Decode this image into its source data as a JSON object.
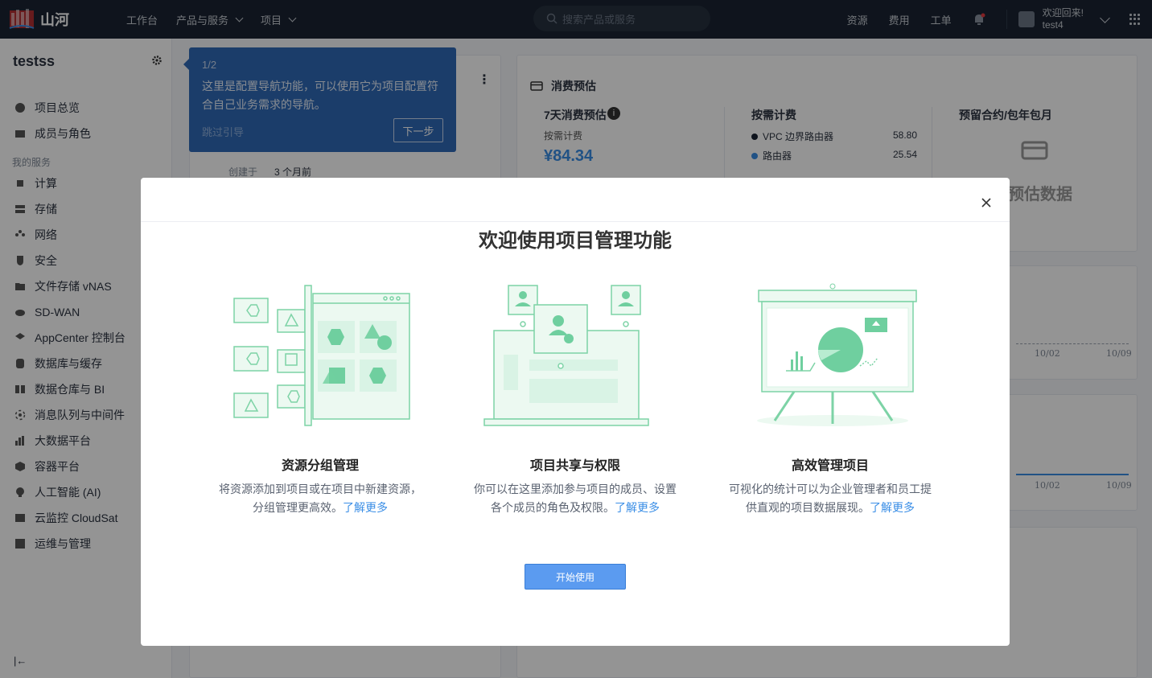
{
  "brand": {
    "name": "山河",
    "accent": "#3a8ee6"
  },
  "topbar": {
    "nav": [
      {
        "label": "工作台",
        "dropdown": false
      },
      {
        "label": "产品与服务",
        "dropdown": true
      },
      {
        "label": "项目",
        "dropdown": true
      }
    ],
    "search_placeholder": "搜索产品或服务",
    "links": [
      "资源",
      "费用",
      "工单"
    ],
    "welcome": "欢迎回来!",
    "username": "test4"
  },
  "sidebar": {
    "project_name": "testss",
    "top_items": [
      {
        "label": "项目总览",
        "icon": "overview-icon"
      },
      {
        "label": "成员与角色",
        "icon": "members-icon"
      }
    ],
    "group_label": "我的服务",
    "service_items": [
      {
        "label": "计算",
        "icon": "compute-icon"
      },
      {
        "label": "存储",
        "icon": "storage-icon"
      },
      {
        "label": "网络",
        "icon": "network-icon"
      },
      {
        "label": "安全",
        "icon": "security-icon"
      },
      {
        "label": "文件存储 vNAS",
        "icon": "folder-icon"
      },
      {
        "label": "SD-WAN",
        "icon": "cloud-icon"
      },
      {
        "label": "AppCenter 控制台",
        "icon": "layers-icon"
      },
      {
        "label": "数据库与缓存",
        "icon": "database-icon"
      },
      {
        "label": "数据仓库与 BI",
        "icon": "warehouse-icon"
      },
      {
        "label": "消息队列与中间件",
        "icon": "queue-icon"
      },
      {
        "label": "大数据平台",
        "icon": "bigdata-icon"
      },
      {
        "label": "容器平台",
        "icon": "container-icon"
      },
      {
        "label": "人工智能 (AI)",
        "icon": "ai-icon"
      },
      {
        "label": "云监控 CloudSat",
        "icon": "monitor-icon"
      },
      {
        "label": "运维与管理",
        "icon": "ops-icon"
      }
    ]
  },
  "tour": {
    "step": "1/2",
    "text": "这里是配置导航功能，可以使用它为项目配置符合自己业务需求的导航。",
    "skip": "跳过引导",
    "next": "下一步"
  },
  "project_card": {
    "created_label": "创建于",
    "created_value": "3 个月前"
  },
  "cost": {
    "title": "消费预估",
    "seven_day": {
      "title": "7天消费预估",
      "subtitle": "按需计费",
      "amount": "¥84.34"
    },
    "on_demand": {
      "title": "按需计费",
      "items": [
        {
          "name": "VPC 边界路由器",
          "value": "58.80",
          "color": "#1a2432"
        },
        {
          "name": "路由器",
          "value": "25.54",
          "color": "#3a8ee6"
        }
      ]
    },
    "reserved": {
      "title": "预留合约/包年包月",
      "empty": "预估数据"
    },
    "chart_ticks": [
      "10/02",
      "10/09"
    ]
  },
  "modal": {
    "title": "欢迎使用项目管理功能",
    "features": [
      {
        "title": "资源分组管理",
        "desc_line1": "将资源添加到项目或在项目中新建资源，",
        "desc_line2": "分组管理更高效。",
        "link": "了解更多"
      },
      {
        "title": "项目共享与权限",
        "desc_line1": "你可以在这里添加参与项目的成员、设置",
        "desc_line2": "各个成员的角色及权限。",
        "link": "了解更多"
      },
      {
        "title": "高效管理项目",
        "desc_line1": "可视化的统计可以为企业管理者和员工提",
        "desc_line2": "供直观的项目数据展现。",
        "link": "了解更多"
      }
    ],
    "start_button": "开始使用",
    "illustration_color": "#6fcf9f"
  }
}
